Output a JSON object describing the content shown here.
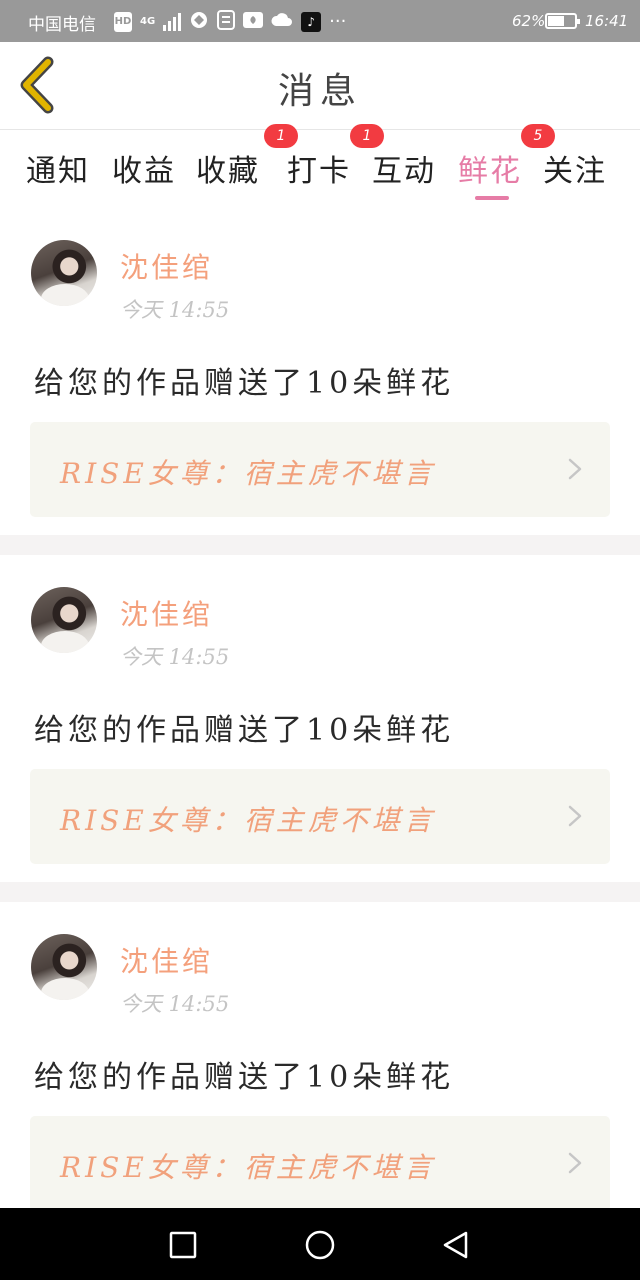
{
  "status_bar": {
    "carrier": "中国电信",
    "icons": [
      "hd-icon",
      "4g-icon",
      "signal-icon",
      "vpn-icon",
      "doc-icon",
      "huawei-icon",
      "cloud-icon",
      "tiktok-icon",
      "more-dots-icon"
    ],
    "hd_label": "HD",
    "network_label": "4G",
    "battery_percent": "62%",
    "battery_level": 0.62,
    "time": "16:41"
  },
  "header": {
    "title": "消息",
    "back_icon": "chevron-left-icon",
    "accent_color": "#e0b400"
  },
  "tabs": {
    "items": [
      {
        "label": "通知",
        "badge": ""
      },
      {
        "label": "收益",
        "badge": ""
      },
      {
        "label": "收藏",
        "badge": ""
      },
      {
        "label": "打卡",
        "badge": "1"
      },
      {
        "label": "互动",
        "badge": "1"
      },
      {
        "label": "鲜花",
        "badge": "5"
      },
      {
        "label": "关注",
        "badge": ""
      }
    ],
    "active": "鲜花",
    "active_color": "#e67ca6",
    "badge_color": "#f23b41"
  },
  "feed": {
    "items": [
      {
        "username": "沈佳绾",
        "time": "今天 14:55",
        "message": "给您的作品赠送了10朵鲜花",
        "reference": "RISE女尊：宿主虎不堪言"
      },
      {
        "username": "沈佳绾",
        "time": "今天 14:55",
        "message": "给您的作品赠送了10朵鲜花",
        "reference": "RISE女尊：宿主虎不堪言"
      },
      {
        "username": "沈佳绾",
        "time": "今天 14:55",
        "message": "给您的作品赠送了10朵鲜花",
        "reference": "RISE女尊：宿主虎不堪言"
      }
    ],
    "username_color": "#f4a07c"
  },
  "nav_bar": {
    "buttons": [
      "recent-apps-icon",
      "home-icon",
      "back-triangle-icon"
    ]
  }
}
